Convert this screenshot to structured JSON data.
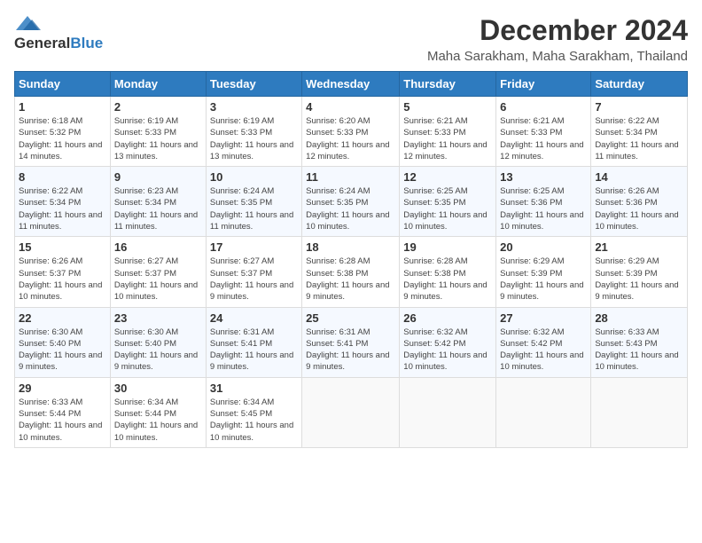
{
  "header": {
    "logo_general": "General",
    "logo_blue": "Blue",
    "month": "December 2024",
    "location": "Maha Sarakham, Maha Sarakham, Thailand"
  },
  "weekdays": [
    "Sunday",
    "Monday",
    "Tuesday",
    "Wednesday",
    "Thursday",
    "Friday",
    "Saturday"
  ],
  "weeks": [
    [
      {
        "day": "1",
        "sunrise": "6:18 AM",
        "sunset": "5:32 PM",
        "daylight": "11 hours and 14 minutes."
      },
      {
        "day": "2",
        "sunrise": "6:19 AM",
        "sunset": "5:33 PM",
        "daylight": "11 hours and 13 minutes."
      },
      {
        "day": "3",
        "sunrise": "6:19 AM",
        "sunset": "5:33 PM",
        "daylight": "11 hours and 13 minutes."
      },
      {
        "day": "4",
        "sunrise": "6:20 AM",
        "sunset": "5:33 PM",
        "daylight": "11 hours and 12 minutes."
      },
      {
        "day": "5",
        "sunrise": "6:21 AM",
        "sunset": "5:33 PM",
        "daylight": "11 hours and 12 minutes."
      },
      {
        "day": "6",
        "sunrise": "6:21 AM",
        "sunset": "5:33 PM",
        "daylight": "11 hours and 12 minutes."
      },
      {
        "day": "7",
        "sunrise": "6:22 AM",
        "sunset": "5:34 PM",
        "daylight": "11 hours and 11 minutes."
      }
    ],
    [
      {
        "day": "8",
        "sunrise": "6:22 AM",
        "sunset": "5:34 PM",
        "daylight": "11 hours and 11 minutes."
      },
      {
        "day": "9",
        "sunrise": "6:23 AM",
        "sunset": "5:34 PM",
        "daylight": "11 hours and 11 minutes."
      },
      {
        "day": "10",
        "sunrise": "6:24 AM",
        "sunset": "5:35 PM",
        "daylight": "11 hours and 11 minutes."
      },
      {
        "day": "11",
        "sunrise": "6:24 AM",
        "sunset": "5:35 PM",
        "daylight": "11 hours and 10 minutes."
      },
      {
        "day": "12",
        "sunrise": "6:25 AM",
        "sunset": "5:35 PM",
        "daylight": "11 hours and 10 minutes."
      },
      {
        "day": "13",
        "sunrise": "6:25 AM",
        "sunset": "5:36 PM",
        "daylight": "11 hours and 10 minutes."
      },
      {
        "day": "14",
        "sunrise": "6:26 AM",
        "sunset": "5:36 PM",
        "daylight": "11 hours and 10 minutes."
      }
    ],
    [
      {
        "day": "15",
        "sunrise": "6:26 AM",
        "sunset": "5:37 PM",
        "daylight": "11 hours and 10 minutes."
      },
      {
        "day": "16",
        "sunrise": "6:27 AM",
        "sunset": "5:37 PM",
        "daylight": "11 hours and 10 minutes."
      },
      {
        "day": "17",
        "sunrise": "6:27 AM",
        "sunset": "5:37 PM",
        "daylight": "11 hours and 9 minutes."
      },
      {
        "day": "18",
        "sunrise": "6:28 AM",
        "sunset": "5:38 PM",
        "daylight": "11 hours and 9 minutes."
      },
      {
        "day": "19",
        "sunrise": "6:28 AM",
        "sunset": "5:38 PM",
        "daylight": "11 hours and 9 minutes."
      },
      {
        "day": "20",
        "sunrise": "6:29 AM",
        "sunset": "5:39 PM",
        "daylight": "11 hours and 9 minutes."
      },
      {
        "day": "21",
        "sunrise": "6:29 AM",
        "sunset": "5:39 PM",
        "daylight": "11 hours and 9 minutes."
      }
    ],
    [
      {
        "day": "22",
        "sunrise": "6:30 AM",
        "sunset": "5:40 PM",
        "daylight": "11 hours and 9 minutes."
      },
      {
        "day": "23",
        "sunrise": "6:30 AM",
        "sunset": "5:40 PM",
        "daylight": "11 hours and 9 minutes."
      },
      {
        "day": "24",
        "sunrise": "6:31 AM",
        "sunset": "5:41 PM",
        "daylight": "11 hours and 9 minutes."
      },
      {
        "day": "25",
        "sunrise": "6:31 AM",
        "sunset": "5:41 PM",
        "daylight": "11 hours and 9 minutes."
      },
      {
        "day": "26",
        "sunrise": "6:32 AM",
        "sunset": "5:42 PM",
        "daylight": "11 hours and 10 minutes."
      },
      {
        "day": "27",
        "sunrise": "6:32 AM",
        "sunset": "5:42 PM",
        "daylight": "11 hours and 10 minutes."
      },
      {
        "day": "28",
        "sunrise": "6:33 AM",
        "sunset": "5:43 PM",
        "daylight": "11 hours and 10 minutes."
      }
    ],
    [
      {
        "day": "29",
        "sunrise": "6:33 AM",
        "sunset": "5:44 PM",
        "daylight": "11 hours and 10 minutes."
      },
      {
        "day": "30",
        "sunrise": "6:34 AM",
        "sunset": "5:44 PM",
        "daylight": "11 hours and 10 minutes."
      },
      {
        "day": "31",
        "sunrise": "6:34 AM",
        "sunset": "5:45 PM",
        "daylight": "11 hours and 10 minutes."
      },
      null,
      null,
      null,
      null
    ]
  ],
  "labels": {
    "sunrise": "Sunrise:",
    "sunset": "Sunset:",
    "daylight": "Daylight:"
  }
}
